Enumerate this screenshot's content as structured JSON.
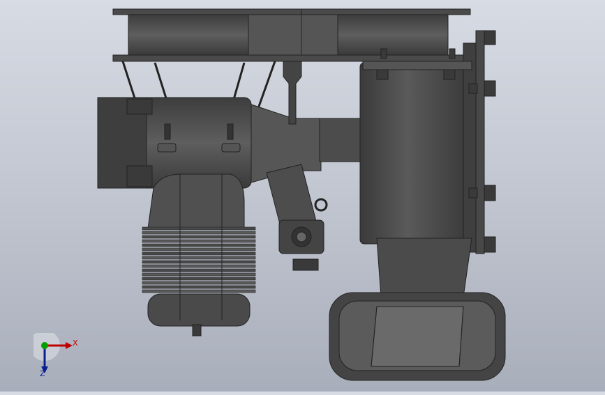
{
  "viewport": {
    "model": "engine-blower-assembly",
    "background_top": "#d7dbe4",
    "background_bottom": "#a9aebb",
    "part_color": "#4a4a4a"
  },
  "triad": {
    "x_label": "X",
    "z_label": "Z",
    "x_color": "#c00000",
    "y_color": "#00a000",
    "z_color": "#0a1f8f"
  }
}
